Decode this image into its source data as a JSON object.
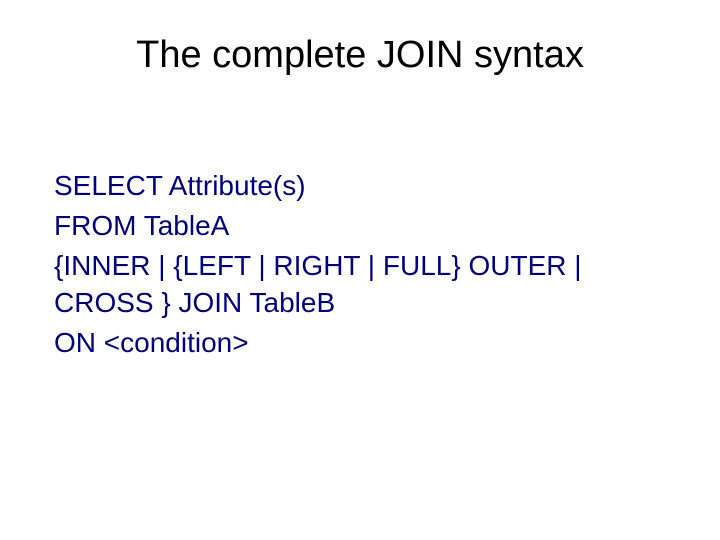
{
  "slide": {
    "title": "The complete JOIN syntax",
    "lines": [
      "SELECT Attribute(s)",
      "FROM TableA",
      "{INNER | {LEFT | RIGHT | FULL} OUTER | CROSS } JOIN TableB",
      "ON <condition>"
    ]
  }
}
